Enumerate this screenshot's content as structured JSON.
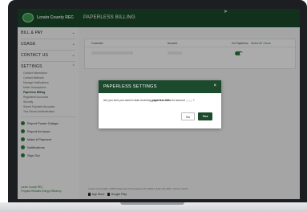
{
  "brand": {
    "name": "Lorain County REC",
    "color": "#1c4a2c",
    "accent": "#2e7d3e"
  },
  "header": {
    "title": "PAPERLESS BILLING"
  },
  "sidebar": {
    "sections": [
      {
        "label": "BILL & PAY",
        "chevron": "⌄"
      },
      {
        "label": "USAGE",
        "chevron": "⌄"
      },
      {
        "label": "CONTACT US",
        "chevron": "⌄"
      },
      {
        "label": "SETTINGS",
        "chevron": "⌃"
      }
    ],
    "settings_items": [
      "Contact Information",
      "Contact Methods",
      "Manage Notifications",
      "Meter Descriptions",
      "Paperless Billing",
      "Registered Accounts",
      "Security",
      "Stored Payment Accounts",
      "Two-Factor Authentication"
    ],
    "active_item": "Paperless Billing",
    "actions": [
      "Report Power Outage",
      "Report An Issue",
      "Make A Payment",
      "Notifications",
      "Sign Out"
    ],
    "footer_links": [
      "Lorain County REC",
      "Program Rebates Energy Efficiency"
    ]
  },
  "table": {
    "columns": {
      "customer": "Customer",
      "account": "Account",
      "go_paperless": "Go Paperless",
      "select_all": "Select All / None"
    },
    "paperless_enabled": true
  },
  "footer": {
    "text": "Lorain County REC  |  22500 State Rte 15 Someplace OH 44060  |  (440) 123-4567  |  Version 14.0.8",
    "app_store": "App Store",
    "google_play": "Google Play"
  },
  "modal": {
    "title": "PAPERLESS SETTINGS",
    "close": "×",
    "message_prefix": "Are you sure you want to start receiving ",
    "message_bold": "paperless bills",
    "message_suffix": " for account",
    "message_end": "?",
    "no_label": "No",
    "yes_label": "Yes"
  }
}
